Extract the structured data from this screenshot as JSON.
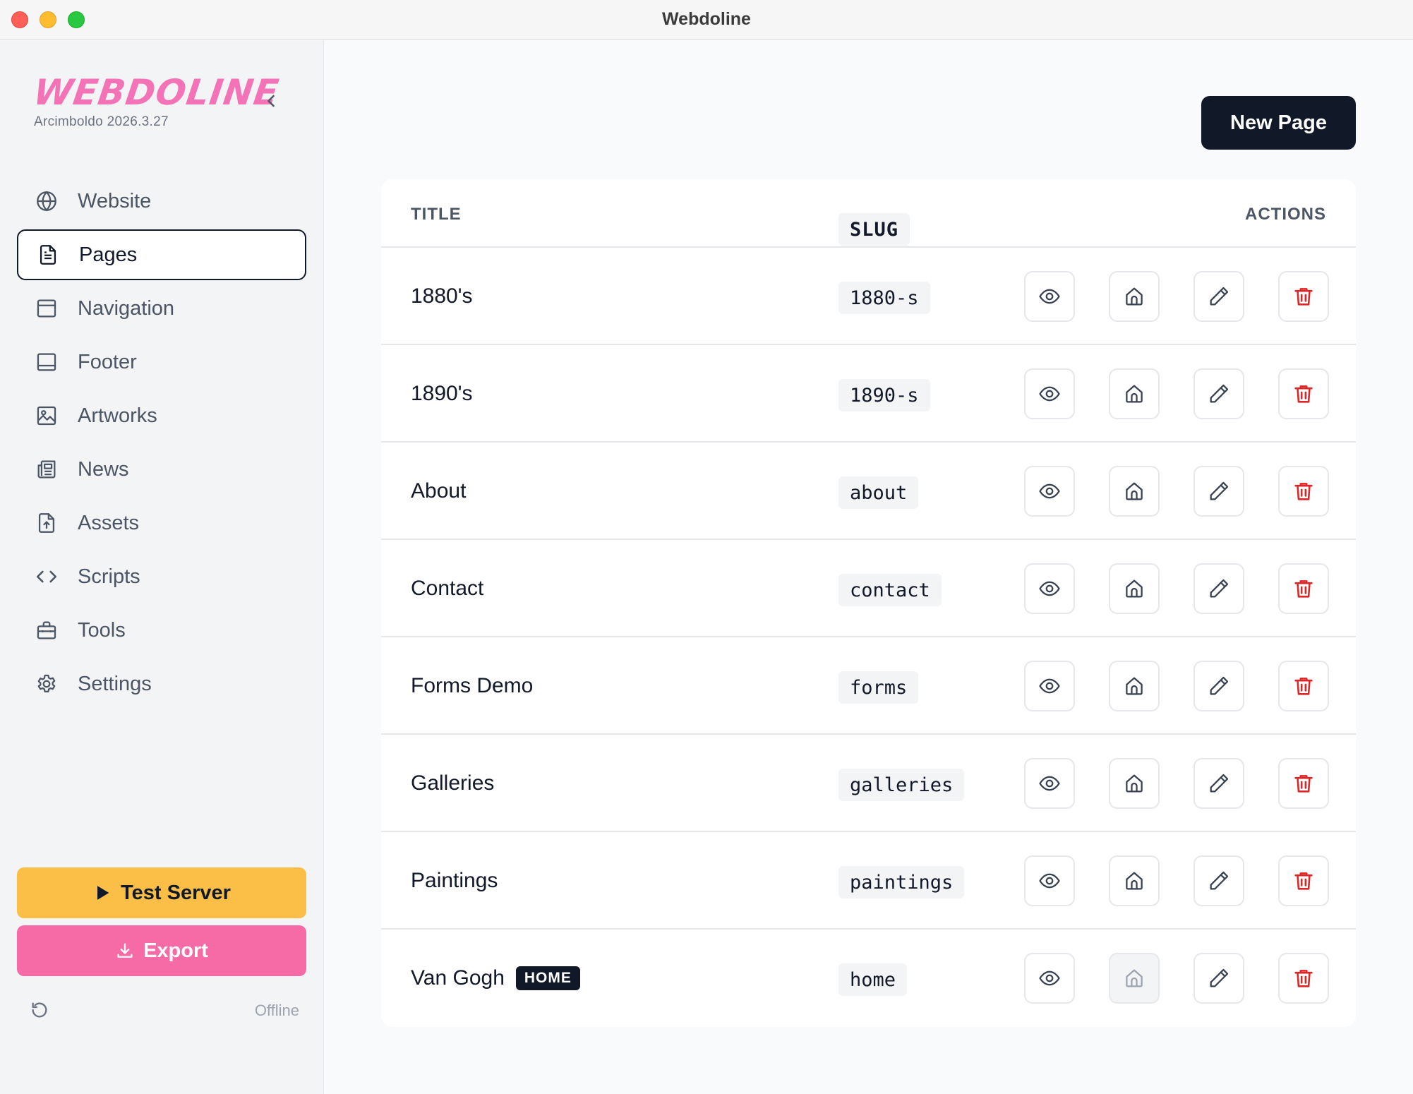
{
  "window": {
    "title": "Webdoline"
  },
  "sidebar": {
    "logo": "WEBDOLINE",
    "version": "Arcimboldo 2026.3.27",
    "items": [
      {
        "label": "Website",
        "icon": "globe-icon"
      },
      {
        "label": "Pages",
        "icon": "file-text-icon",
        "active": true
      },
      {
        "label": "Navigation",
        "icon": "layout-icon"
      },
      {
        "label": "Footer",
        "icon": "footer-icon"
      },
      {
        "label": "Artworks",
        "icon": "image-icon"
      },
      {
        "label": "News",
        "icon": "newspaper-icon"
      },
      {
        "label": "Assets",
        "icon": "file-upload-icon"
      },
      {
        "label": "Scripts",
        "icon": "code-icon"
      },
      {
        "label": "Tools",
        "icon": "toolbox-icon"
      },
      {
        "label": "Settings",
        "icon": "gear-icon"
      }
    ],
    "test_server_label": "Test Server",
    "export_label": "Export",
    "status": "Offline"
  },
  "main": {
    "new_page_label": "New Page",
    "table": {
      "headers": {
        "title": "TITLE",
        "slug": "SLUG",
        "actions": "ACTIONS"
      },
      "rows": [
        {
          "title": "1880's",
          "slug": "1880-s",
          "is_home": false
        },
        {
          "title": "1890's",
          "slug": "1890-s",
          "is_home": false
        },
        {
          "title": "About",
          "slug": "about",
          "is_home": false
        },
        {
          "title": "Contact",
          "slug": "contact",
          "is_home": false
        },
        {
          "title": "Forms Demo",
          "slug": "forms",
          "is_home": false
        },
        {
          "title": "Galleries",
          "slug": "galleries",
          "is_home": false
        },
        {
          "title": "Paintings",
          "slug": "paintings",
          "is_home": false
        },
        {
          "title": "Van Gogh",
          "slug": "home",
          "is_home": true,
          "badge": "HOME"
        }
      ]
    }
  },
  "colors": {
    "accent_pink": "#f66aa6",
    "accent_yellow": "#fbbf47",
    "dark": "#111827",
    "delete_red": "#dc2626"
  }
}
